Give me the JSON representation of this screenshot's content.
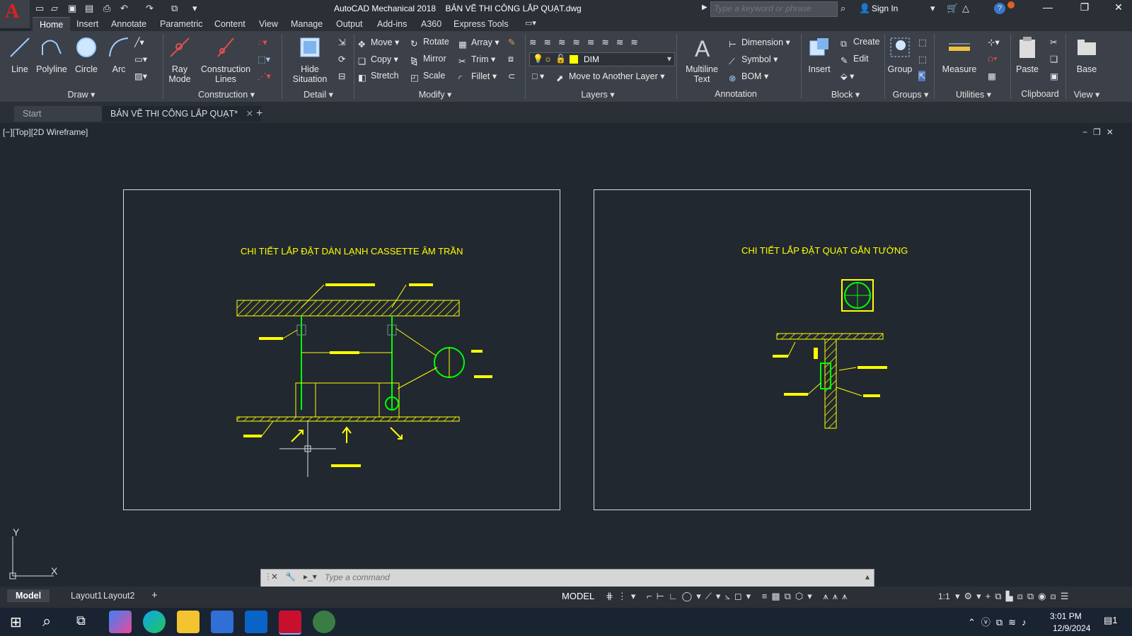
{
  "window": {
    "app_name": "AutoCAD Mechanical 2018",
    "file_name": "BẢN VẼ THI CÔNG LẮP QUẠT.dwg",
    "search_placeholder": "Type a keyword or phrase",
    "sign_in": "Sign In"
  },
  "ribbon_tabs": [
    "Home",
    "Insert",
    "Annotate",
    "Parametric",
    "Content",
    "View",
    "Manage",
    "Output",
    "Add-ins",
    "A360",
    "Express Tools"
  ],
  "ribbon": {
    "draw": {
      "title": "Draw",
      "line": "Line",
      "polyline": "Polyline",
      "circle": "Circle",
      "arc": "Arc"
    },
    "construction": {
      "title": "Construction",
      "ray_mode_1": "Ray",
      "ray_mode_2": "Mode",
      "construction_lines_1": "Construction",
      "construction_lines_2": "Lines"
    },
    "detail": {
      "title": "Detail",
      "hide_situation_1": "Hide",
      "hide_situation_2": "Situation"
    },
    "modify": {
      "title": "Modify",
      "move": "Move",
      "rotate": "Rotate",
      "array": "Array",
      "copy": "Copy",
      "mirror": "Mirror",
      "trim": "Trim",
      "stretch": "Stretch",
      "scale": "Scale",
      "fillet": "Fillet"
    },
    "layers": {
      "title": "Layers",
      "current_layer": "DIM",
      "move_to_layer": "Move to Another Layer"
    },
    "annotation": {
      "title": "Annotation",
      "multiline_text_1": "Multiline",
      "multiline_text_2": "Text",
      "dimension": "Dimension",
      "symbol": "Symbol",
      "bom": "BOM"
    },
    "block": {
      "title": "Block",
      "insert": "Insert",
      "create": "Create",
      "edit": "Edit"
    },
    "groups": {
      "title": "Groups",
      "group": "Group"
    },
    "utilities": {
      "title": "Utilities",
      "measure": "Measure"
    },
    "clipboard": {
      "title": "Clipboard",
      "paste": "Paste"
    },
    "view": {
      "title": "View",
      "base": "Base"
    }
  },
  "doc_tabs": {
    "start": "Start",
    "active": "BẢN VẼ THI CÔNG LẮP QUẠT*"
  },
  "viewport": {
    "label": "[−][Top][2D Wireframe]",
    "sheet1_title": "CHI TIẾT LẮP ĐẶT DÀN LẠNH CASSETTE ÂM TRẦN",
    "sheet2_title": "CHI TIẾT LẮP ĐẶT QUẠT GẮN TƯỜNG",
    "ucs_y": "Y",
    "ucs_x": "X"
  },
  "command": {
    "placeholder": "Type a command"
  },
  "layout_tabs": [
    "Model",
    "Layout1",
    "Layout2"
  ],
  "status": {
    "model": "MODEL",
    "scale": "1:1"
  },
  "taskbar": {
    "time": "3:01 PM",
    "date": "12/9/2024",
    "notifications": "1"
  },
  "colors": {
    "drawing_yellow": "#ffff00",
    "drawing_green": "#00ff00",
    "viewport_bg": "#212830"
  }
}
